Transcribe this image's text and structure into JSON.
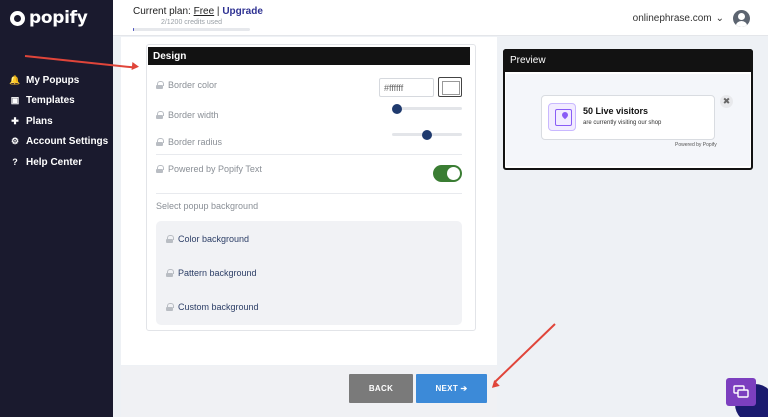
{
  "sidebar": {
    "logo_text": "popify",
    "items": [
      {
        "label": "My Popups",
        "icon": "bell-icon",
        "glyph": "🔔"
      },
      {
        "label": "Templates",
        "icon": "template-icon",
        "glyph": "▣"
      },
      {
        "label": "Plans",
        "icon": "grid-icon",
        "glyph": "✚"
      },
      {
        "label": "Account Settings",
        "icon": "gear-icon",
        "glyph": "⚙"
      },
      {
        "label": "Help Center",
        "icon": "help-icon",
        "glyph": "?"
      }
    ]
  },
  "topbar": {
    "plan_prefix": "Current plan: ",
    "plan_name": "Free",
    "separator": " | ",
    "upgrade_label": "Upgrade",
    "credits_text": "2/1200 credits used",
    "credits_used_fraction": 0.0017,
    "domain": "onlinephrase.com",
    "chevron": "⌄"
  },
  "design": {
    "header": "Design",
    "border_color_label": "Border color",
    "border_color_value": "#ffffff",
    "border_width_label": "Border width",
    "border_radius_label": "Border radius",
    "powered_label": "Powered by Popify Text",
    "powered_enabled": true,
    "bg_section_title": "Select popup background",
    "bg_options": [
      "Color background",
      "Pattern background",
      "Custom background"
    ]
  },
  "footer": {
    "back_label": "BACK",
    "next_label": "NEXT ➔"
  },
  "preview": {
    "title": "Preview",
    "popup_title": "50 Live visitors",
    "popup_subtitle": "are currently visiting our shop",
    "close_glyph": "✖",
    "powered_text": "Powered by Popify"
  },
  "colors": {
    "sidebar_bg": "#1a1a2e",
    "accent": "#2e3192",
    "next_button": "#3c8ad8",
    "back_button": "#7a7a7a",
    "toggle_on": "#3a7d33",
    "arrow": "#e0453a",
    "chat_widget": "#7c3fbf"
  }
}
